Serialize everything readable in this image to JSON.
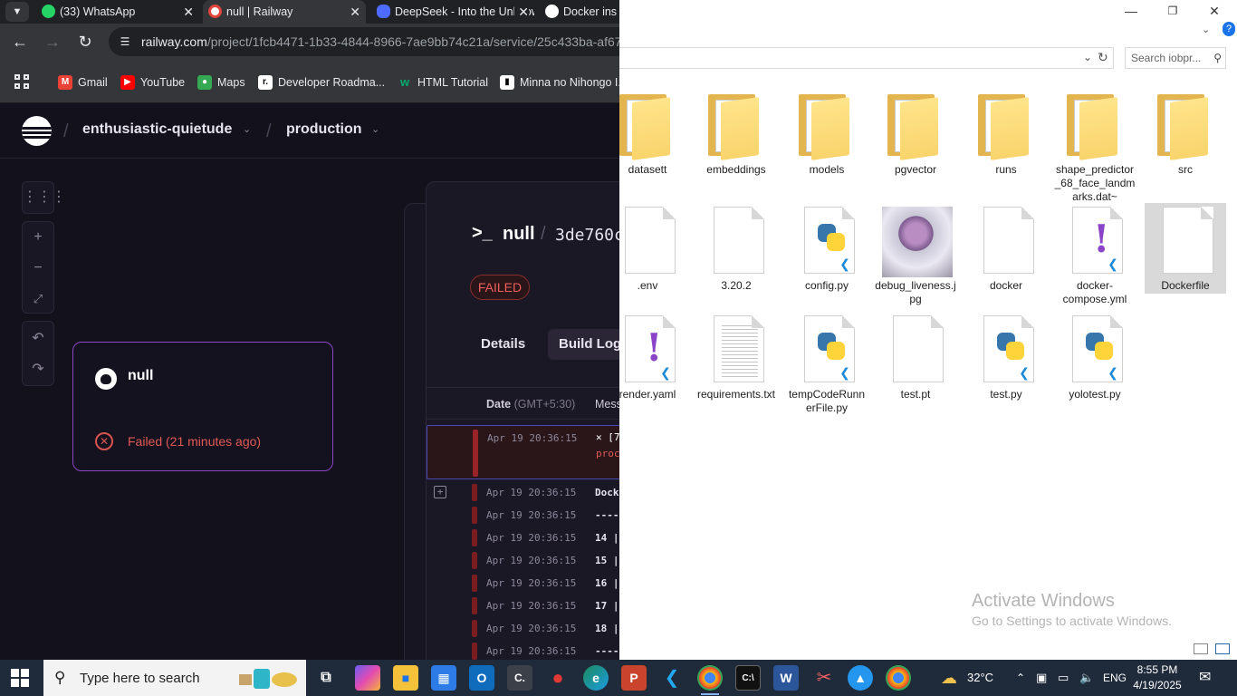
{
  "chrome": {
    "tabs": [
      {
        "label": "(33) WhatsApp",
        "icon": "whatsapp-icon"
      },
      {
        "label": "null | Railway",
        "icon": "railway-icon"
      },
      {
        "label": "DeepSeek - Into the Unknown",
        "icon": "deepseek-icon"
      },
      {
        "label": "Docker ins",
        "icon": "github-icon"
      }
    ],
    "url_host": "railway.com",
    "url_path": "/project/1fcb4471-1b33-4844-8966-7ae9bb74c21a/service/25c433ba-af67",
    "bookmarks": [
      "Gmail",
      "YouTube",
      "Maps",
      "Developer Roadma...",
      "HTML Tutorial",
      "Minna no Nihongo I..."
    ]
  },
  "railway": {
    "project": "enthusiastic-quietude",
    "environment": "production",
    "service": {
      "name": "null",
      "status": "Failed (21 minutes ago)"
    },
    "panel": {
      "prompt": ">_",
      "service_name": "null",
      "deploy_id": "3de760c",
      "badge": "FAILED",
      "tabs": [
        "Details",
        "Build Logs"
      ],
      "log_header_date": "Date",
      "log_header_tz": "(GMT+5:30)",
      "log_header_msg": "Message",
      "error_row": {
        "time": "Apr 19 20:36:15",
        "line1": "✕ [7",
        "line2": "proc"
      },
      "rows": [
        {
          "time": "Apr 19 20:36:15",
          "msg": "Dock"
        },
        {
          "time": "Apr 19 20:36:15",
          "msg": "----"
        },
        {
          "time": "Apr 19 20:36:15",
          "msg": "14 |"
        },
        {
          "time": "Apr 19 20:36:15",
          "msg": "15 |"
        },
        {
          "time": "Apr 19 20:36:15",
          "msg": "16 |"
        },
        {
          "time": "Apr 19 20:36:15",
          "msg": "17 |"
        },
        {
          "time": "Apr 19 20:36:15",
          "msg": "18 |"
        },
        {
          "time": "Apr 19 20:36:15",
          "msg": "----"
        }
      ]
    }
  },
  "explorer": {
    "search_placeholder": "Search iobpr...",
    "items": [
      {
        "name": "datasett",
        "kind": "folder"
      },
      {
        "name": "embeddings",
        "kind": "folder"
      },
      {
        "name": "models",
        "kind": "folder"
      },
      {
        "name": "pgvector",
        "kind": "folder"
      },
      {
        "name": "runs",
        "kind": "folder"
      },
      {
        "name": "shape_predictor_68_face_landmarks.dat~",
        "kind": "folder"
      },
      {
        "name": "src",
        "kind": "folder"
      },
      {
        "name": ".env",
        "kind": "file"
      },
      {
        "name": "3.20.2",
        "kind": "file"
      },
      {
        "name": "config.py",
        "kind": "python"
      },
      {
        "name": "debug_liveness.jpg",
        "kind": "image"
      },
      {
        "name": "docker",
        "kind": "file"
      },
      {
        "name": "docker-compose.yml",
        "kind": "yaml"
      },
      {
        "name": "Dockerfile",
        "kind": "file"
      },
      {
        "name": "render.yaml",
        "kind": "yaml"
      },
      {
        "name": "requirements.txt",
        "kind": "text"
      },
      {
        "name": "tempCodeRunnerFile.py",
        "kind": "python"
      },
      {
        "name": "test.pt",
        "kind": "file"
      },
      {
        "name": "test.py",
        "kind": "python"
      },
      {
        "name": "yolotest.py",
        "kind": "python"
      }
    ],
    "watermark_title": "Activate Windows",
    "watermark_sub": "Go to Settings to activate Windows."
  },
  "taskbar": {
    "search_text": "Type here to search",
    "weather": "32°C",
    "language": "ENG",
    "time": "8:55 PM",
    "date": "4/19/2025"
  }
}
